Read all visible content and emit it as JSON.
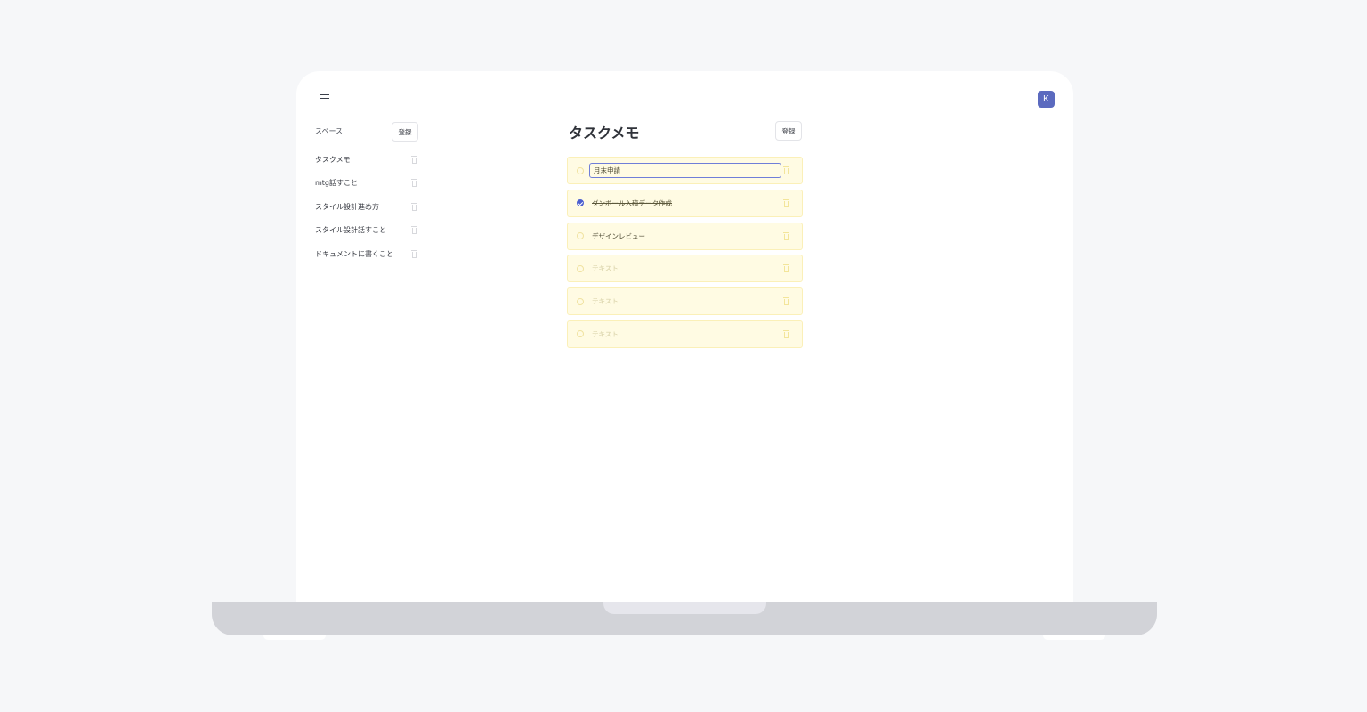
{
  "header": {
    "menu_icon": "hamburger-menu-icon",
    "avatar_initial": "K",
    "avatar_color": "#5b6abf"
  },
  "sidebar": {
    "label": "スペース",
    "register_label": "登録",
    "items": [
      {
        "label": "タスクメモ"
      },
      {
        "label": "mtg話すこと"
      },
      {
        "label": "スタイル設計進め方"
      },
      {
        "label": "スタイル設計話すこと"
      },
      {
        "label": "ドキュメントに書くこと"
      }
    ]
  },
  "main": {
    "title": "タスクメモ",
    "register_label": "登録",
    "tasks": [
      {
        "text": "月末申請",
        "done": false,
        "editing": true
      },
      {
        "text": "ダンボール入稿データ作成",
        "done": true
      },
      {
        "text": "デザインレビュー",
        "done": false
      },
      {
        "text": "テキスト",
        "done": false,
        "placeholder": true
      },
      {
        "text": "テキスト",
        "done": false,
        "placeholder": true
      },
      {
        "text": "テキスト",
        "done": false,
        "placeholder": true
      }
    ]
  },
  "colors": {
    "accent": "#4c5fcf",
    "task_background": "#fffbe3",
    "page_background": "#f6f7f9"
  }
}
